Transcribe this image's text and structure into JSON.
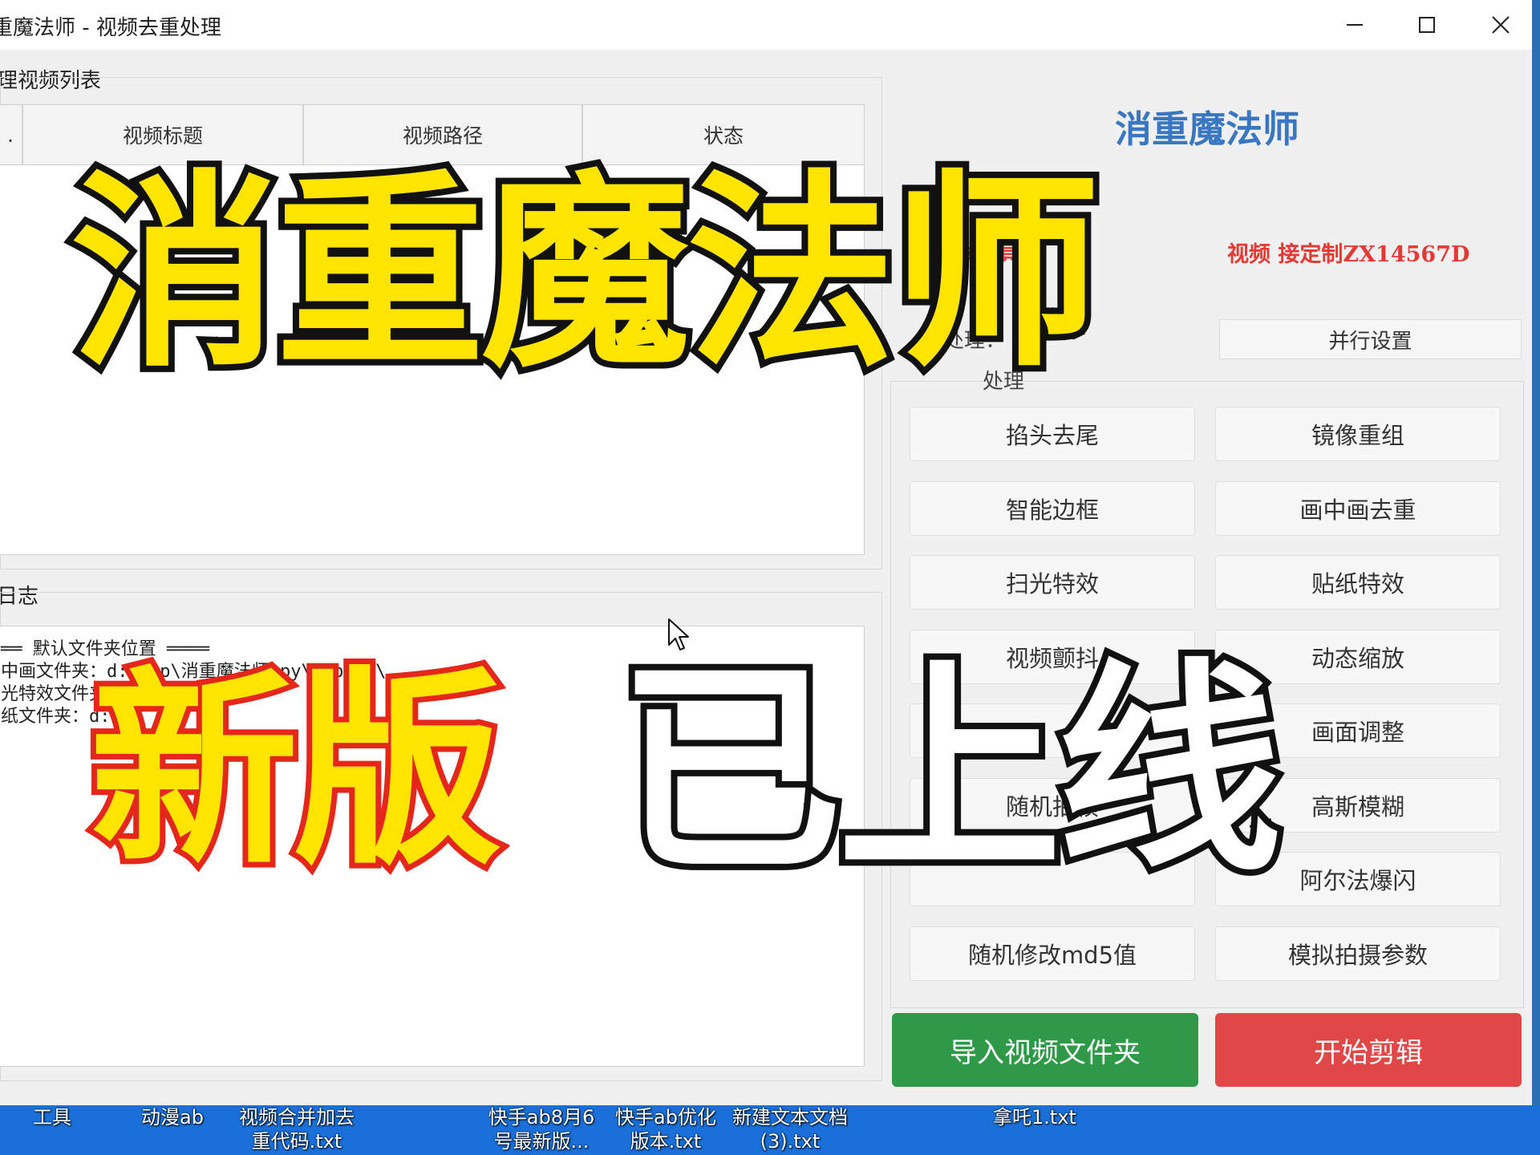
{
  "window": {
    "title": "重魔法师 - 视频去重处理",
    "controls": {
      "minimize": "minimize-icon",
      "maximize": "maximize-icon",
      "close": "close-icon"
    }
  },
  "video_list": {
    "group_label": "理视频列表",
    "columns": [
      ".",
      "视频标题",
      "视频路径",
      "状态"
    ]
  },
  "log": {
    "group_label": "日志",
    "lines": [
      "══ 默认文件夹位置 ════",
      "中画文件夹：d:\\tmp\\消重魔法师.py\\pip_ok\\",
      "光特效文件夹：",
      "纸文件夹：d:"
    ]
  },
  "right_panel": {
    "app_heading": "消重魔法师",
    "notice_left": "本工具",
    "notice_right": "视频  接定制ZX14567D",
    "parallel_label": "行处理：",
    "parallel_button": "并行设置",
    "processing_label": "处理",
    "effects": [
      [
        "掐头去尾",
        "镜像重组"
      ],
      [
        "智能边框",
        "画中画去重"
      ],
      [
        "扫光特效",
        "贴纸特效"
      ],
      [
        "视频颤抖",
        "动态缩放"
      ],
      [
        "",
        "画面调整"
      ],
      [
        "随机抽帧",
        "高斯模糊"
      ],
      [
        "",
        "阿尔法爆闪"
      ],
      [
        "随机修改md5值",
        "模拟拍摄参数"
      ]
    ],
    "import_button": "导入视频文件夹",
    "start_button": "开始剪辑",
    "colors": {
      "heading": "#3a77c2",
      "notice": "#e53935",
      "import": "#2e9a47",
      "start": "#e04848"
    }
  },
  "desktop_icons": [
    {
      "line1": "工具",
      "line2": ""
    },
    {
      "line1": "动漫ab",
      "line2": ""
    },
    {
      "line1": "视频合并加去",
      "line2": "重代码.txt"
    },
    {
      "line1": "快手ab8月6",
      "line2": "号最新版..."
    },
    {
      "line1": "快手ab优化",
      "line2": "版本.txt"
    },
    {
      "line1": "新建文本文档",
      "line2": "(3).txt"
    },
    {
      "line1": "拿吒1.txt",
      "line2": ""
    }
  ],
  "overlay": {
    "title": "消重魔法师",
    "new": "新版",
    "online": "已上线",
    "colors": {
      "yellow": "#ffe400",
      "red_stroke": "#e4261b",
      "black_stroke": "#111111"
    }
  }
}
